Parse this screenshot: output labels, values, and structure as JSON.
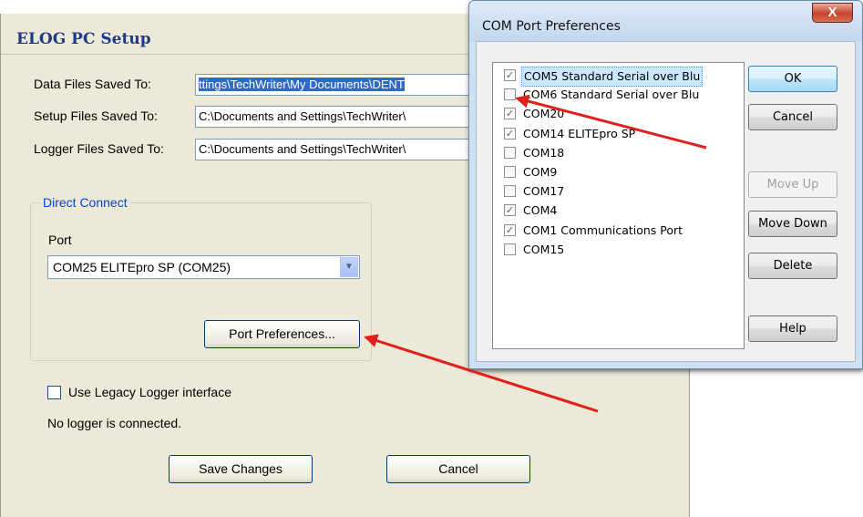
{
  "elog": {
    "title": "ELOG PC Setup",
    "rows": [
      {
        "label": "Data Files Saved To:",
        "value": "ttings\\TechWriter\\My Documents\\DENT"
      },
      {
        "label": "Setup Files Saved To:",
        "value": "C:\\Documents and Settings\\TechWriter\\"
      },
      {
        "label": "Logger Files Saved To:",
        "value": "C:\\Documents and Settings\\TechWriter\\"
      }
    ],
    "direct_connect": {
      "legend": "Direct Connect",
      "port_label": "Port",
      "port_value": "COM25 ELITEpro SP (COM25)",
      "preferences_button": "Port Preferences..."
    },
    "legacy_checkbox": {
      "label": "Use Legacy Logger interface",
      "checked": false
    },
    "status": "No logger is connected.",
    "save_button": "Save Changes",
    "cancel_button": "Cancel"
  },
  "com_dialog": {
    "title": "COM Port Preferences",
    "close_glyph": "X",
    "ports": [
      {
        "label": "COM5 Standard Serial over Blu",
        "checked": true,
        "selected": true
      },
      {
        "label": "COM6 Standard Serial over Blu",
        "checked": false,
        "selected": false
      },
      {
        "label": "COM20",
        "checked": true,
        "selected": false
      },
      {
        "label": "COM14 ELITEpro SP",
        "checked": true,
        "selected": false
      },
      {
        "label": "COM18",
        "checked": false,
        "selected": false
      },
      {
        "label": "COM9",
        "checked": false,
        "selected": false
      },
      {
        "label": "COM17",
        "checked": false,
        "selected": false
      },
      {
        "label": "COM4",
        "checked": true,
        "selected": false
      },
      {
        "label": "COM1 Communications Port",
        "checked": true,
        "selected": false
      },
      {
        "label": "COM15",
        "checked": false,
        "selected": false
      }
    ],
    "buttons": {
      "ok": "OK",
      "cancel": "Cancel",
      "move_up": "Move Up",
      "move_down": "Move Down",
      "delete": "Delete",
      "help": "Help"
    }
  },
  "colors": {
    "annotation_arrow": "#e0211b",
    "title_blue": "#1f3b87",
    "group_legend": "#0046d5"
  }
}
